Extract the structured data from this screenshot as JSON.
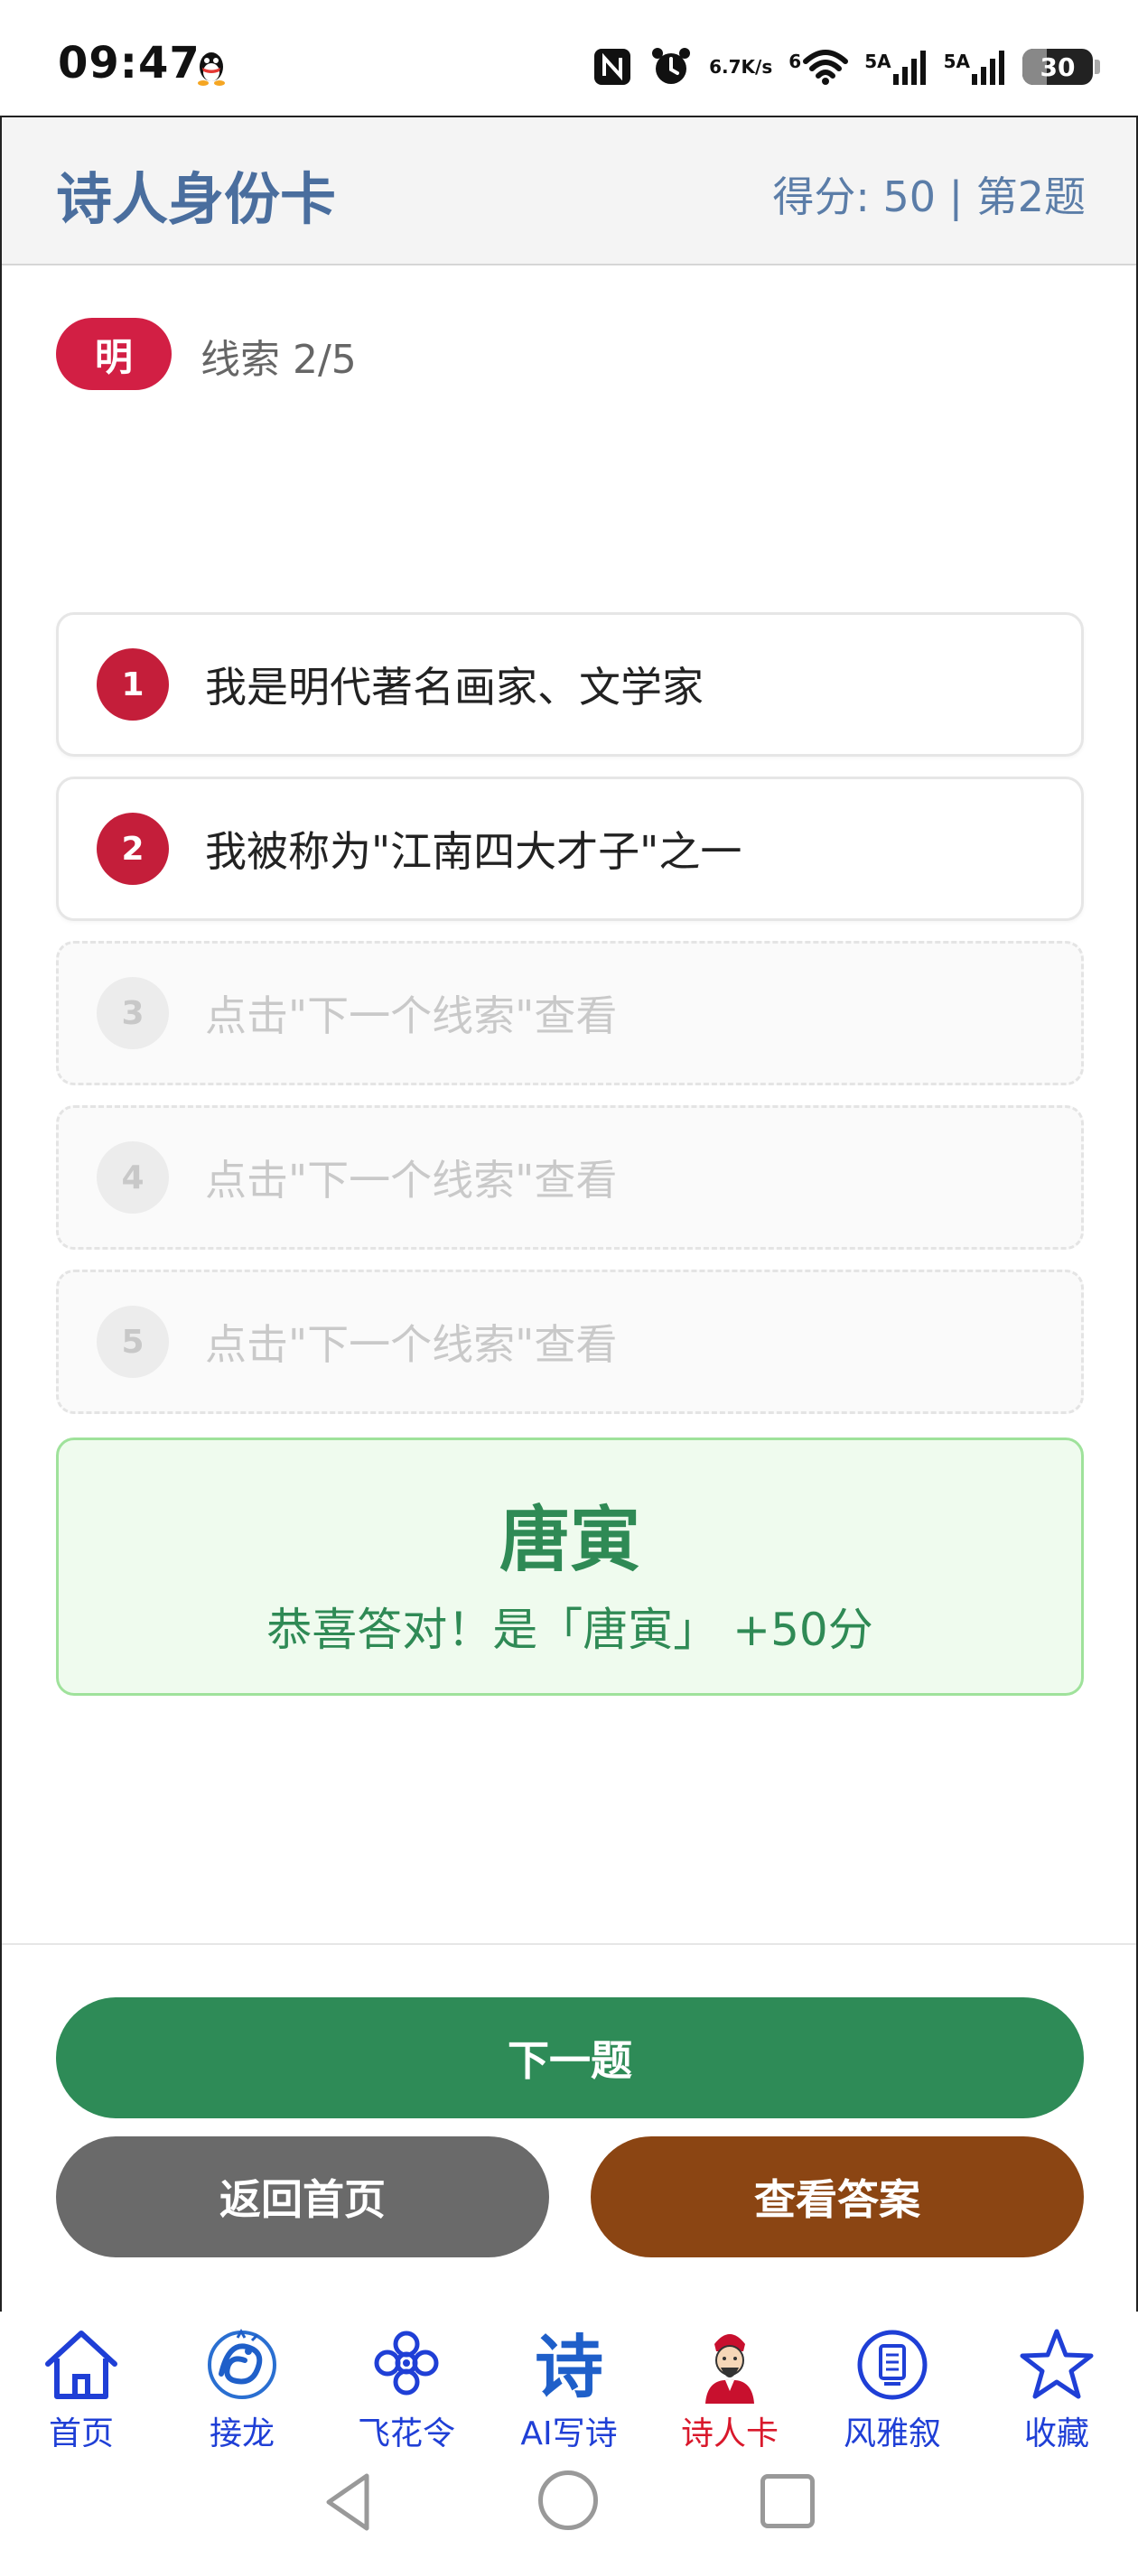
{
  "status_bar": {
    "time": "09:47",
    "net_speed_value": "6.7",
    "net_speed_unit": "K/s",
    "wifi_label": "6",
    "signal1_label": "5A",
    "signal2_label": "5A",
    "battery": "30"
  },
  "header": {
    "title": "诗人身份卡",
    "score_info": "得分: 50 | 第2题"
  },
  "game": {
    "dynasty": "明",
    "clue_progress": "线索 2/5",
    "clues": [
      {
        "number": "1",
        "text": "我是明代著名画家、文学家",
        "revealed": true
      },
      {
        "number": "2",
        "text": "我被称为\"江南四大才子\"之一",
        "revealed": true
      },
      {
        "number": "3",
        "text": "点击\"下一个线索\"查看",
        "revealed": false
      },
      {
        "number": "4",
        "text": "点击\"下一个线索\"查看",
        "revealed": false
      },
      {
        "number": "5",
        "text": "点击\"下一个线索\"查看",
        "revealed": false
      }
    ],
    "answer": {
      "name": "唐寅",
      "message": "恭喜答对！是「唐寅」 +50分"
    }
  },
  "actions": {
    "next": "下一题",
    "home": "返回首页",
    "show_answer": "查看答案"
  },
  "tabs": [
    {
      "label": "首页",
      "icon": "home-icon",
      "active": false
    },
    {
      "label": "接龙",
      "icon": "dragon-icon",
      "active": false
    },
    {
      "label": "飞花令",
      "icon": "flower-icon",
      "active": false
    },
    {
      "label": "AI写诗",
      "icon": "poem-char-icon",
      "active": false
    },
    {
      "label": "诗人卡",
      "icon": "poet-portrait-icon",
      "active": true
    },
    {
      "label": "风雅叙",
      "icon": "scroll-circle-icon",
      "active": false
    },
    {
      "label": "收藏",
      "icon": "star-icon",
      "active": false
    }
  ],
  "colors": {
    "title_blue": "#4a6e9e",
    "badge_red": "#d21f44",
    "clue_red": "#c41e3a",
    "success_green": "#2e8b57",
    "home_gray": "#6a6a6a",
    "answer_brown": "#8b4513",
    "tab_blue": "#1f3fd6",
    "tab_active_red": "#d9182b"
  }
}
